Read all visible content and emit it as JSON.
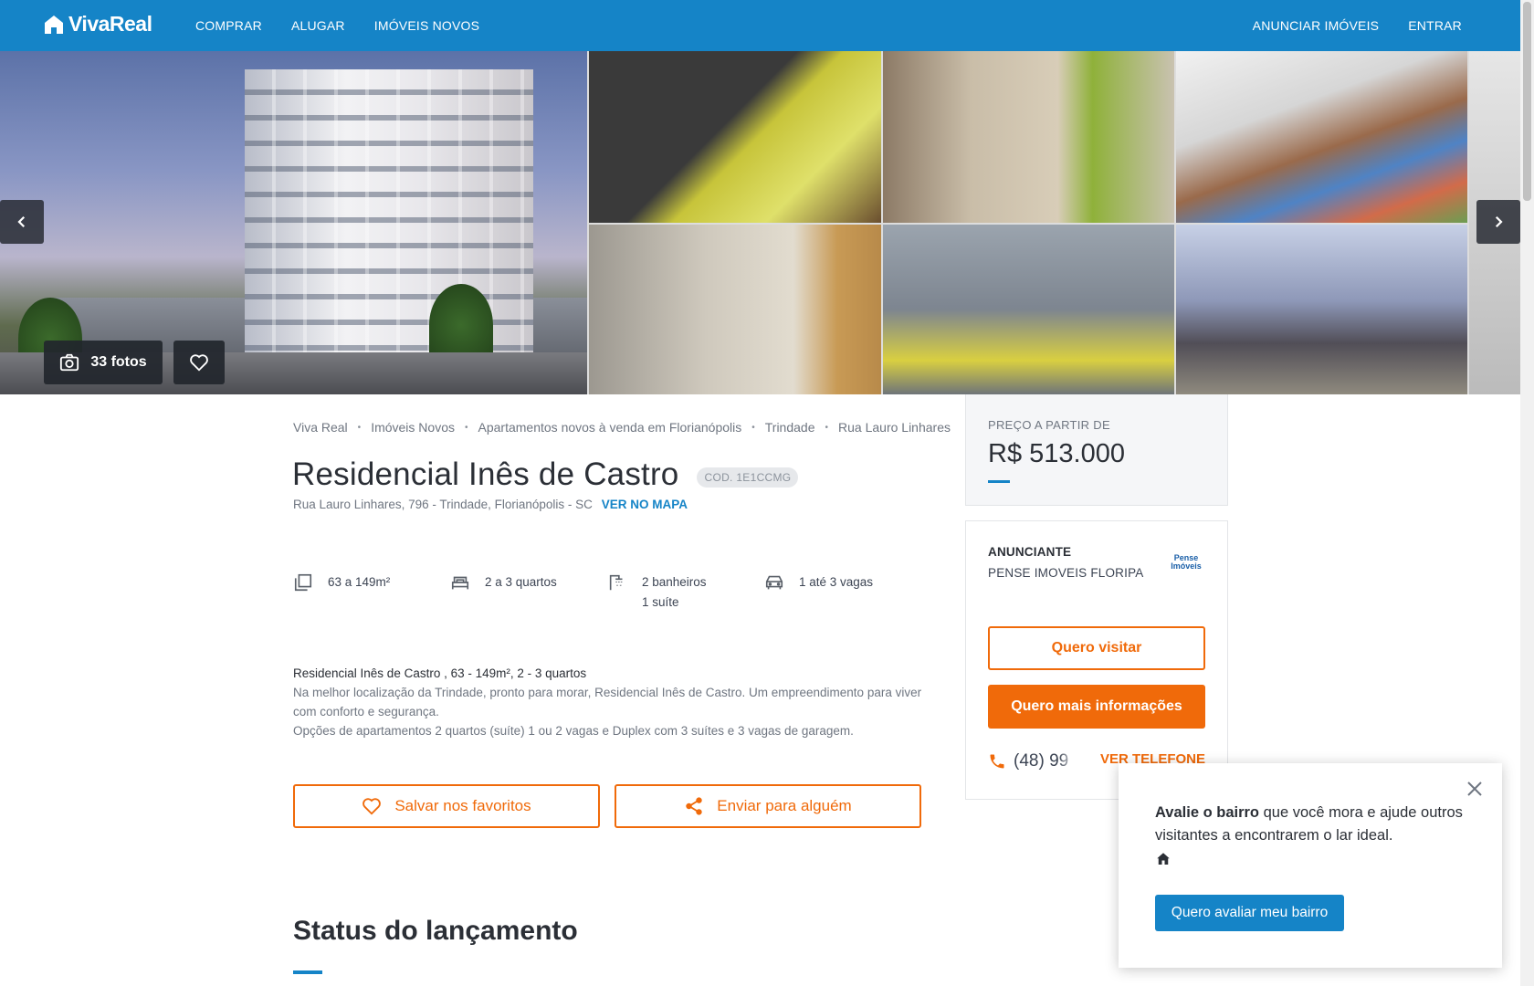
{
  "header": {
    "logo_text": "VivaReal",
    "nav": [
      "COMPRAR",
      "ALUGAR",
      "IMÓVEIS NOVOS"
    ],
    "nav_right": [
      "ANUNCIAR IMÓVEIS",
      "ENTRAR"
    ]
  },
  "gallery": {
    "photos_label": "33 fotos"
  },
  "breadcrumb": [
    "Viva Real",
    "Imóveis Novos",
    "Apartamentos novos à venda em Florianópolis",
    "Trindade",
    "Rua Lauro Linhares"
  ],
  "listing": {
    "title": "Residencial Inês de Castro",
    "code": "COD. 1E1CCMG",
    "address": "Rua Lauro Linhares, 796 - Trindade, Florianópolis - SC",
    "map_link": "VER NO MAPA",
    "features": {
      "area": "63 a 149m²",
      "bedrooms": "2 a 3 quartos",
      "bathrooms": "2 banheiros",
      "suites": "1 suíte",
      "parking": "1 até 3 vagas"
    },
    "description_title": "Residencial Inês de Castro , 63 - 149m², 2 - 3 quartos",
    "description_lines": [
      "Na melhor localização da Trindade, pronto para morar, Residencial Inês de Castro. Um empreendimento para viver com conforto e segurança.",
      "Opções de apartamentos 2 quartos (suíte) 1 ou 2 vagas e Duplex com 3 suítes e 3 vagas de garagem."
    ],
    "save_label": "Salvar nos favoritos",
    "send_label": "Enviar para alguém",
    "status_title": "Status do lançamento"
  },
  "sidebar": {
    "price_label": "PREÇO A PARTIR DE",
    "price": "R$ 513.000",
    "advertiser_label": "ANUNCIANTE",
    "advertiser_name": "PENSE IMOVEIS FLORIPA",
    "advertiser_logo": "Pense Imóveis",
    "visit_label": "Quero visitar",
    "info_label": "Quero mais informações",
    "phone_partial": "(48) 99",
    "phone_link": "VER TELEFONE"
  },
  "popup": {
    "bold_text": "Avalie o bairro",
    "text": " que você mora e ajude outros visitantes a encontrarem o lar ideal.",
    "button_label": "Quero avaliar meu bairro"
  },
  "colors": {
    "brand_blue": "#1584c7",
    "accent_orange": "#f06a0a"
  }
}
